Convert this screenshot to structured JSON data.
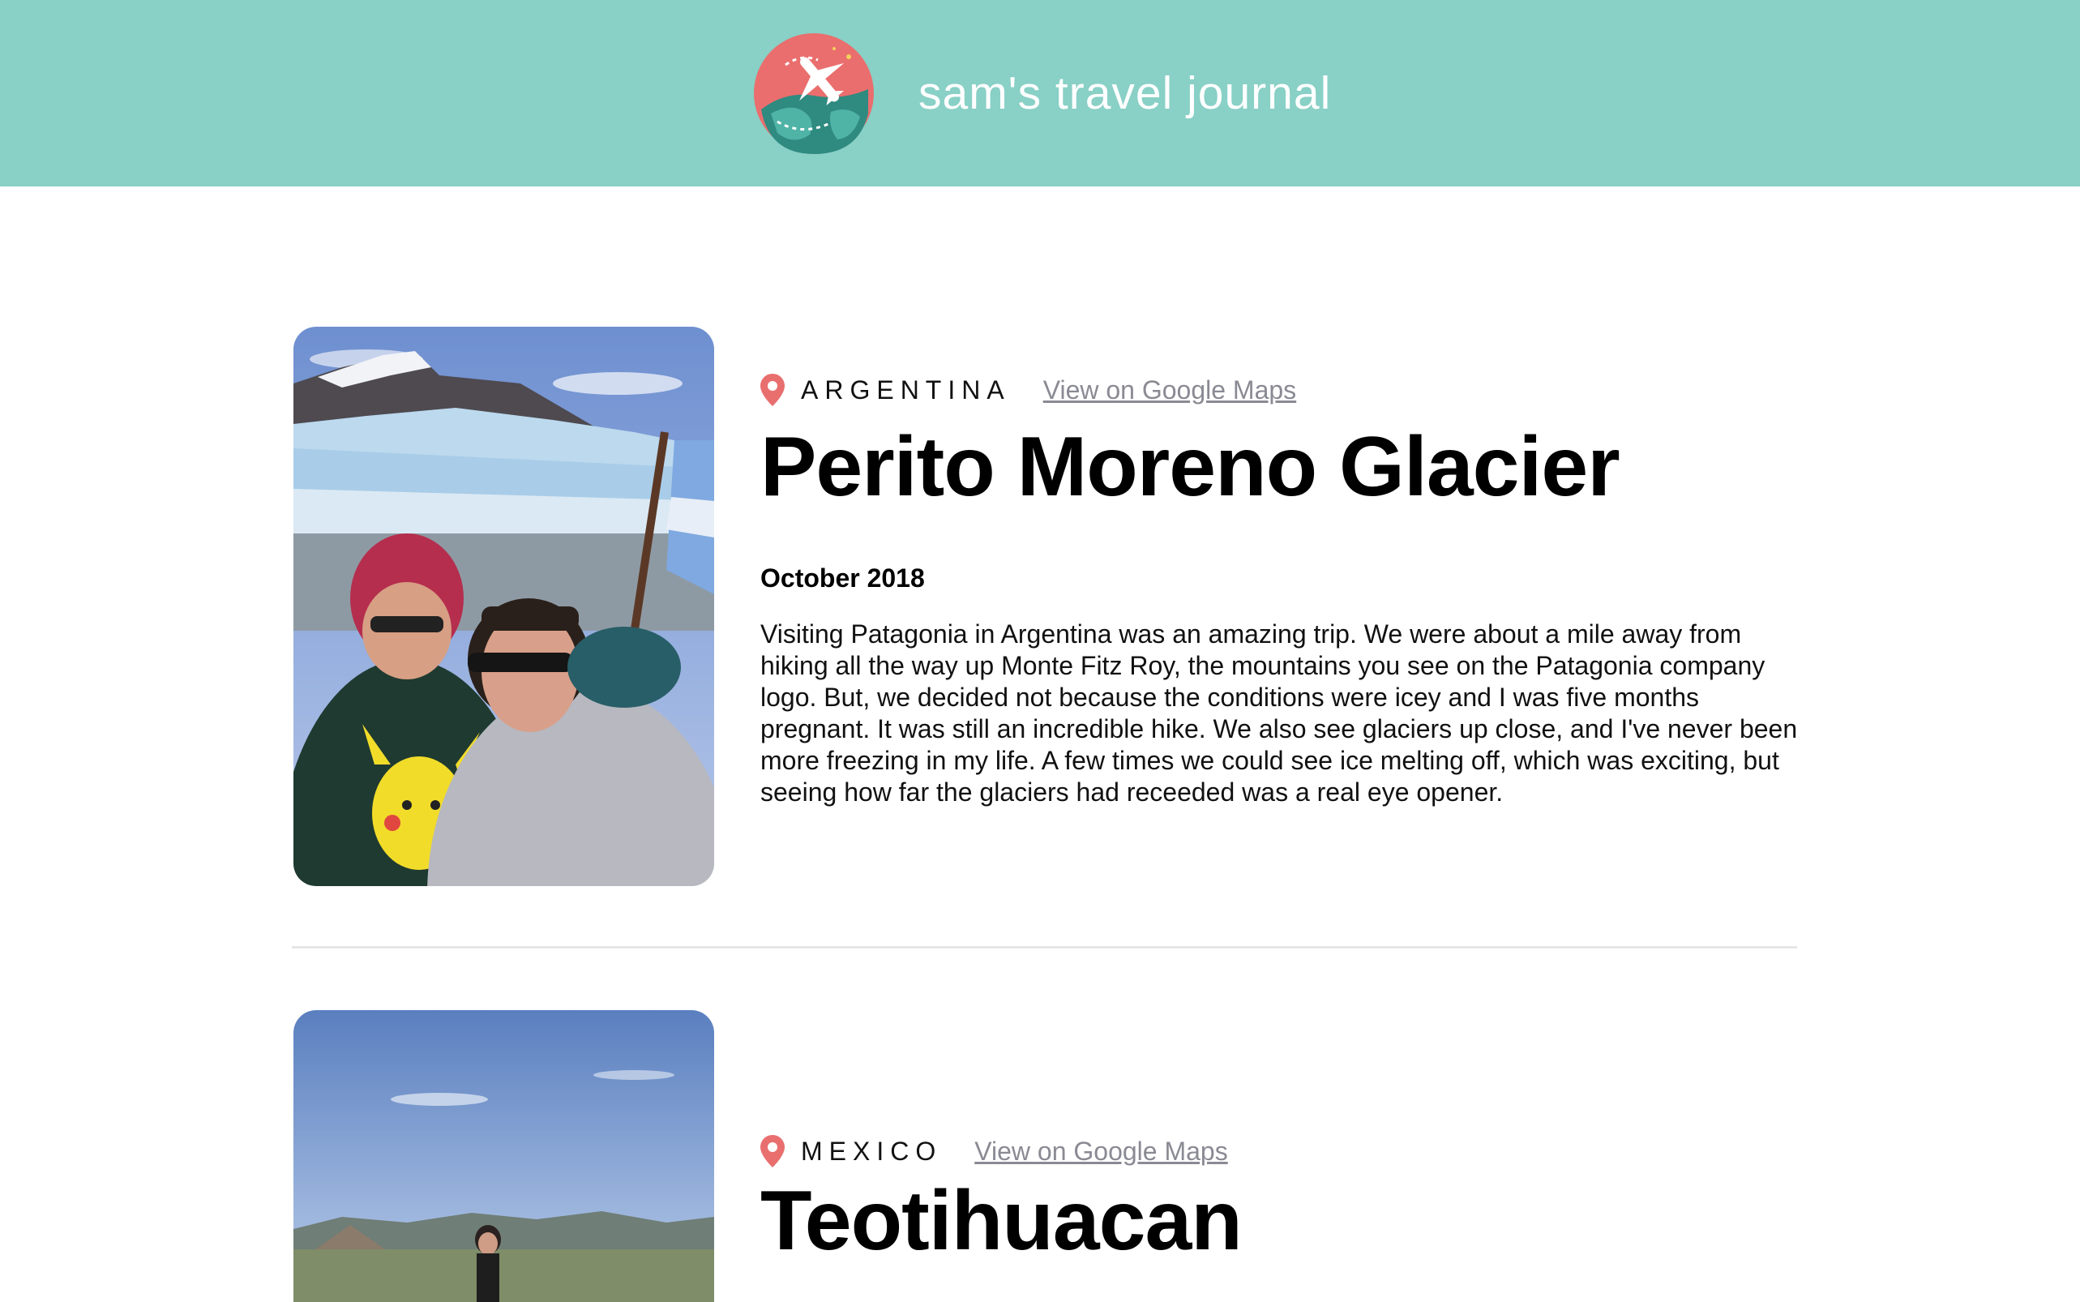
{
  "header": {
    "logo_icon": "globe-airplane-icon",
    "title": "sam's travel journal",
    "background_color": "#89d0c6"
  },
  "entries": [
    {
      "location_icon": "map-pin-icon",
      "country": "ARGENTINA",
      "maps_link": "View on Google Maps",
      "title": "Perito Moreno Glacier",
      "date": "October 2018",
      "text": "Visiting Patagonia in Argentina was an amazing trip. We were about a mile away from hiking all the way up Monte Fitz Roy, the mountains you see on the Patagonia company logo. But, we decided not because the conditions were icey and I was five months pregnant. It was still an incredible hike. We also see glaciers up close, and I've never been more freezing in my life. A few times we could see ice melting off, which was exciting, but seeing how far the glaciers had receeded was a real eye opener."
    },
    {
      "location_icon": "map-pin-icon",
      "country": "MEXICO",
      "maps_link": "View on Google Maps",
      "title": "Teotihuacan"
    }
  ],
  "colors": {
    "pin": "#e96f6f",
    "link": "#8a8a94"
  }
}
